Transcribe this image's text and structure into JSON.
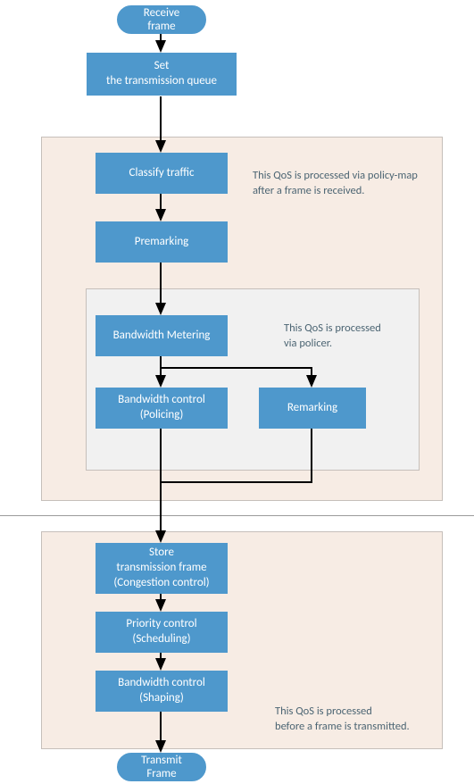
{
  "nodes": {
    "receive": "Receive frame",
    "set_queue": "Set\nthe transmission queue",
    "classify": "Classify traffic",
    "premarking": "Premarking",
    "metering": "Bandwidth Metering",
    "policing": "Bandwidth control\n(Policing)",
    "remarking": "Remarking",
    "store": "Store\ntransmission frame\n(Congestion control)",
    "scheduling": "Priority control\n(Scheduling)",
    "shaping": "Bandwidth control\n(Shaping)",
    "transmit": "Transmit Frame"
  },
  "notes": {
    "policy_map": "This QoS is processed via policy-map\nafter a frame is received.",
    "policer": "This QoS is processed\nvia policer.",
    "before_tx": "This QoS is processed\nbefore a frame is transmitted."
  }
}
